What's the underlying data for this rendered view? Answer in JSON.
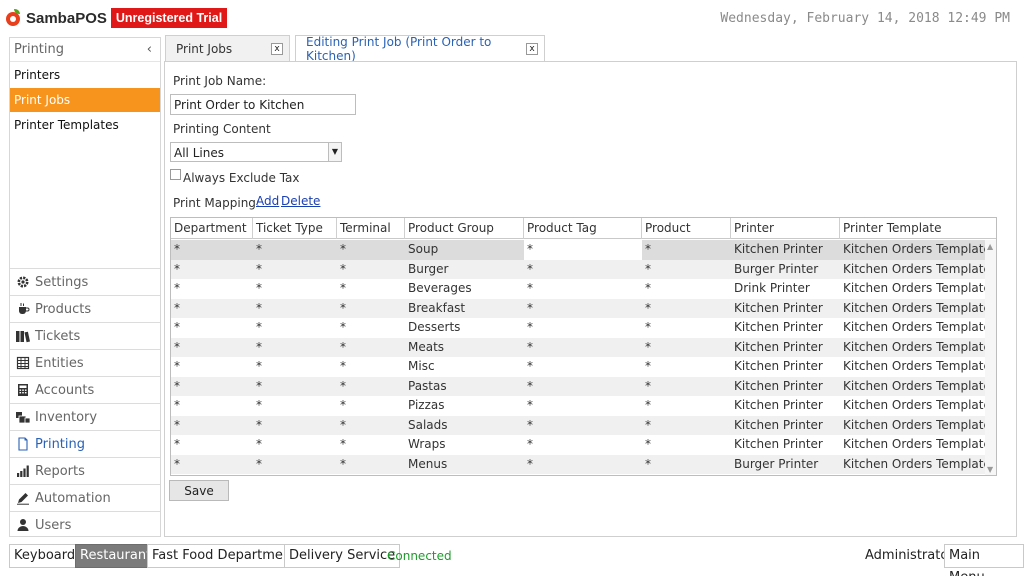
{
  "header": {
    "app_name": "SambaPOS",
    "trial_badge": "Unregistered Trial",
    "datetime": "Wednesday, February 14, 2018 12:49 PM"
  },
  "left_panel": {
    "title": "Printing",
    "collapse_glyph": "‹",
    "items": [
      {
        "label": "Printers"
      },
      {
        "label": "Print Jobs"
      },
      {
        "label": "Printer Templates"
      }
    ]
  },
  "nav": {
    "items": [
      {
        "label": "Settings",
        "icon": "gear-icon"
      },
      {
        "label": "Products",
        "icon": "cup-icon"
      },
      {
        "label": "Tickets",
        "icon": "tickets-icon"
      },
      {
        "label": "Entities",
        "icon": "entities-icon"
      },
      {
        "label": "Accounts",
        "icon": "calculator-icon"
      },
      {
        "label": "Inventory",
        "icon": "inventory-icon"
      },
      {
        "label": "Printing",
        "icon": "printer-icon"
      },
      {
        "label": "Reports",
        "icon": "bar-chart-icon"
      },
      {
        "label": "Automation",
        "icon": "pen-icon"
      },
      {
        "label": "Users",
        "icon": "user-icon"
      }
    ]
  },
  "tabs": [
    {
      "label": "Print Jobs",
      "close": "x"
    },
    {
      "label": "Editing Print Job (Print Order to Kitchen)",
      "close": "x"
    }
  ],
  "form": {
    "name_label": "Print Job Name:",
    "name_value": "Print Order to Kitchen",
    "content_label": "Printing Content",
    "content_value": "All Lines",
    "exclude_tax_label": "Always Exclude Tax",
    "mapping_label": "Print Mapping:",
    "add_label": "Add",
    "delete_label": "Delete",
    "save_label": "Save"
  },
  "grid": {
    "columns": [
      "Department",
      "Ticket Type",
      "Terminal",
      "Product Group",
      "Product Tag",
      "Product",
      "Printer",
      "Printer Template"
    ],
    "rows": [
      [
        "*",
        "*",
        "*",
        "Soup",
        "*",
        "*",
        "Kitchen Printer",
        "Kitchen Orders Template"
      ],
      [
        "*",
        "*",
        "*",
        "Burger",
        "*",
        "*",
        "Burger Printer",
        "Kitchen Orders Template"
      ],
      [
        "*",
        "*",
        "*",
        "Beverages",
        "*",
        "*",
        "Drink Printer",
        "Kitchen Orders Template"
      ],
      [
        "*",
        "*",
        "*",
        "Breakfast",
        "*",
        "*",
        "Kitchen Printer",
        "Kitchen Orders Template"
      ],
      [
        "*",
        "*",
        "*",
        "Desserts",
        "*",
        "*",
        "Kitchen Printer",
        "Kitchen Orders Template"
      ],
      [
        "*",
        "*",
        "*",
        "Meats",
        "*",
        "*",
        "Kitchen Printer",
        "Kitchen Orders Template"
      ],
      [
        "*",
        "*",
        "*",
        "Misc",
        "*",
        "*",
        "Kitchen Printer",
        "Kitchen Orders Template"
      ],
      [
        "*",
        "*",
        "*",
        "Pastas",
        "*",
        "*",
        "Kitchen Printer",
        "Kitchen Orders Template"
      ],
      [
        "*",
        "*",
        "*",
        "Pizzas",
        "*",
        "*",
        "Kitchen Printer",
        "Kitchen Orders Template"
      ],
      [
        "*",
        "*",
        "*",
        "Salads",
        "*",
        "*",
        "Kitchen Printer",
        "Kitchen Orders Template"
      ],
      [
        "*",
        "*",
        "*",
        "Wraps",
        "*",
        "*",
        "Kitchen Printer",
        "Kitchen Orders Template"
      ],
      [
        "*",
        "*",
        "*",
        "Menus",
        "*",
        "*",
        "Burger Printer",
        "Kitchen Orders Template"
      ]
    ]
  },
  "footer": {
    "keyboard": "Keyboard",
    "restaurant": "Restaurant",
    "fast_food": "Fast Food Department",
    "delivery": "Delivery Service",
    "status": "Connected",
    "user": "Administrator",
    "main_menu": "Main Menu"
  },
  "colors": {
    "accent_orange": "#f7941d",
    "badge_red": "#e01818",
    "status_green": "#1c9c2a",
    "link_blue": "#2a62b5"
  }
}
